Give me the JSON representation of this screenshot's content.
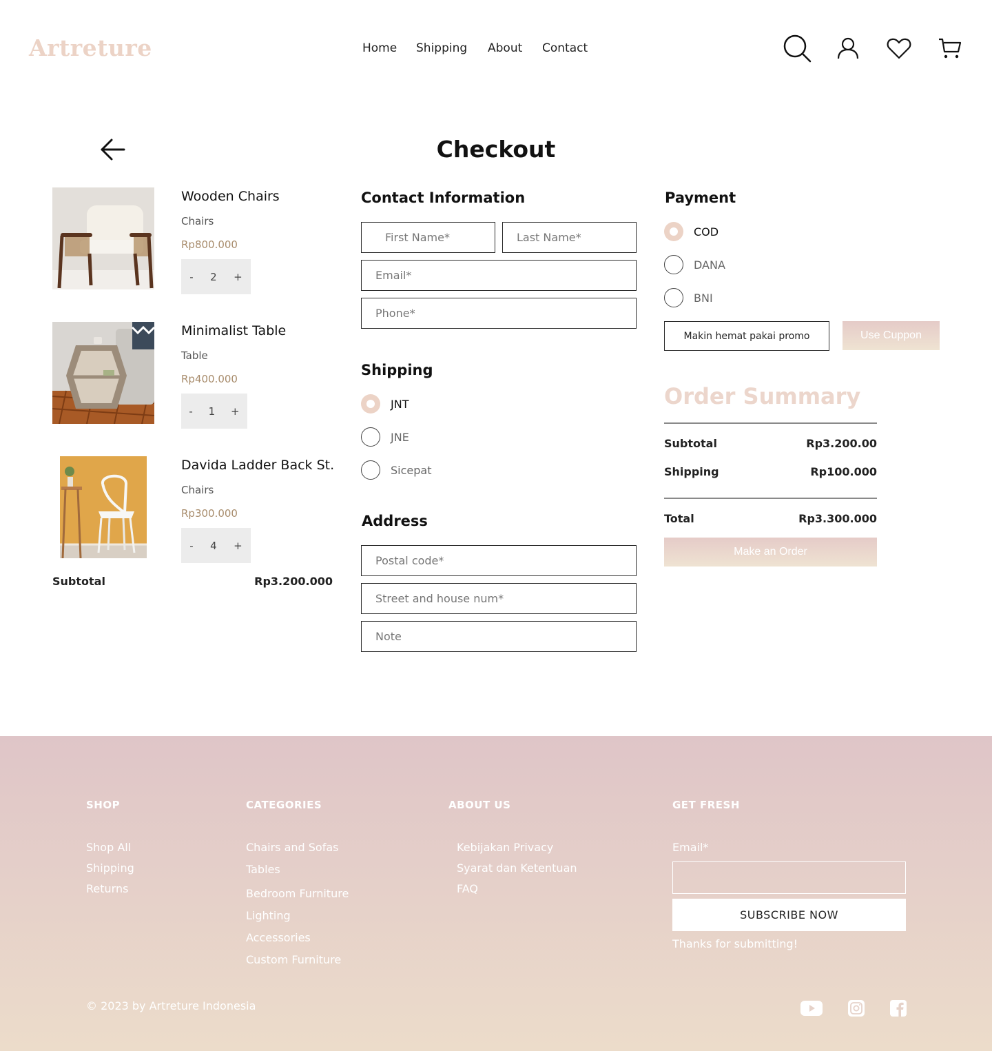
{
  "brand": {
    "logo": "Artreture",
    "accent": "#ecd3c6"
  },
  "nav": [
    {
      "label": "Home"
    },
    {
      "label": "Shipping"
    },
    {
      "label": "About"
    },
    {
      "label": "Contact"
    }
  ],
  "header_icons": [
    "search-icon",
    "user-icon",
    "heart-icon",
    "cart-icon"
  ],
  "page": {
    "title": "Checkout",
    "back_icon": "arrow-left-icon"
  },
  "cart": {
    "items": [
      {
        "name": "Wooden Chairs",
        "category": "Chairs",
        "price": "Rp800.000",
        "qty": "2",
        "minus": "-",
        "plus": "+"
      },
      {
        "name": "Minimalist Table",
        "category": "Table",
        "price": "Rp400.000",
        "qty": "1",
        "minus": "-",
        "plus": "+"
      },
      {
        "name": "Davida Ladder Back St...",
        "category": "Chairs",
        "price": "Rp300.000",
        "qty": "4",
        "minus": "-",
        "plus": "+"
      }
    ],
    "subtotal_label": "Subtotal",
    "subtotal_value": "Rp3.200.000"
  },
  "contact": {
    "heading": "Contact Information",
    "first_name": "First Name*",
    "last_name": "Last Name*",
    "email": "Email*",
    "phone": "Phone*"
  },
  "shipping": {
    "heading": "Shipping",
    "options": [
      {
        "label": "JNT",
        "selected": true
      },
      {
        "label": "JNE",
        "selected": false
      },
      {
        "label": "Sicepat",
        "selected": false
      }
    ]
  },
  "address": {
    "heading": "Address",
    "postal": "Postal code*",
    "street": "Street and house num*",
    "note": "Note"
  },
  "payment": {
    "heading": "Payment",
    "options": [
      {
        "label": "COD",
        "selected": true
      },
      {
        "label": "DANA",
        "selected": false
      },
      {
        "label": "BNI",
        "selected": false
      }
    ],
    "promo_text": "Makin hemat pakai promo",
    "coupon_button": "Use Cuppon"
  },
  "summary": {
    "title": "Order Summary",
    "subtotal_label": "Subtotal",
    "subtotal_value": "Rp3.200.00",
    "shipping_label": "Shipping",
    "shipping_value": "Rp100.000",
    "total_label": "Total",
    "total_value": "Rp3.300.000",
    "order_button": "Make an Order"
  },
  "footer": {
    "shop": {
      "heading": "SHOP",
      "links": [
        "Shop All",
        "Shipping",
        "Returns"
      ]
    },
    "categories": {
      "heading": "CATEGORIES",
      "links": [
        "Chairs and Sofas",
        "Tables",
        "Bedroom Furniture",
        "Lighting",
        "Accessories",
        "Custom Furniture"
      ]
    },
    "about": {
      "heading": "ABOUT US",
      "links": [
        "Kebijakan Privacy",
        "Syarat dan Ketentuan",
        "FAQ"
      ]
    },
    "fresh": {
      "heading": "GET FRESH",
      "email_label": "Email*",
      "subscribe": "SUBSCRIBE NOW",
      "thanks": "Thanks for submitting!"
    },
    "copyright": "© 2023 by Artreture Indonesia",
    "social": [
      "youtube-icon",
      "instagram-icon",
      "facebook-icon"
    ]
  }
}
